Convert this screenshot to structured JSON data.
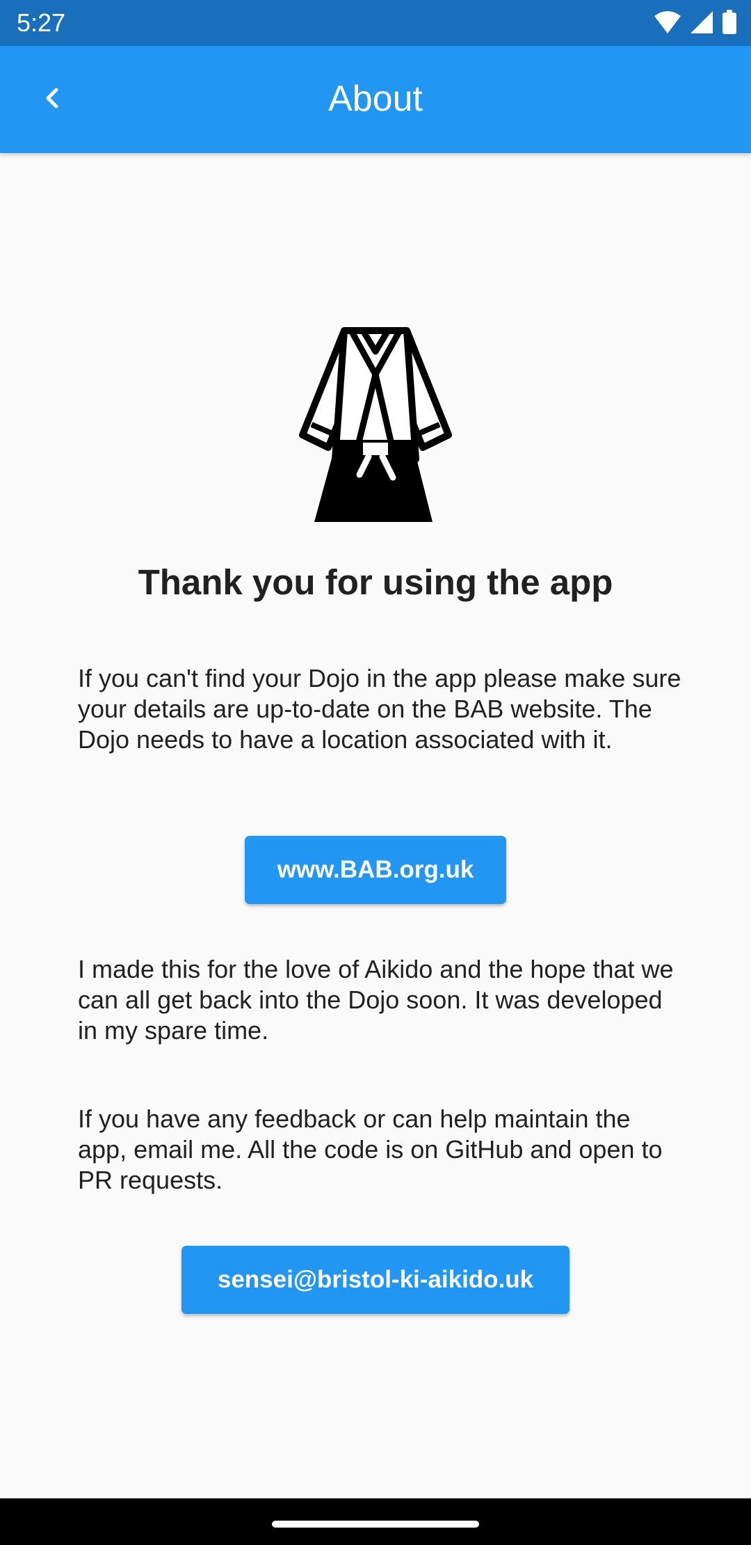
{
  "status_bar": {
    "time": "5:27",
    "icons": [
      "wifi-icon",
      "cellular-signal-icon",
      "battery-icon"
    ]
  },
  "app_bar": {
    "title": "About",
    "back_icon": "chevron-left-icon"
  },
  "hero": {
    "icon": "karate-gi-icon"
  },
  "content": {
    "heading": "Thank you for using the app",
    "paragraph_1": "If you can't find your Dojo in the app please make sure your details are up-to-date on the BAB website. The Dojo needs to have a location associated with it.",
    "website_button": "www.BAB.org.uk",
    "paragraph_2": "I made this for the love of Aikido and the hope that we can all get back into the Dojo soon. It was developed in my spare time.",
    "paragraph_3": "If you have any feedback or can help maintain the app, email me. All the code is on GitHub and open to PR requests.",
    "email_button": "sensei@bristol-ki-aikido.uk"
  },
  "colors": {
    "status_bar": "#1a6fbc",
    "app_bar": "#2196f3",
    "button": "#2196f3",
    "background": "#fafafa",
    "text": "#212121"
  }
}
